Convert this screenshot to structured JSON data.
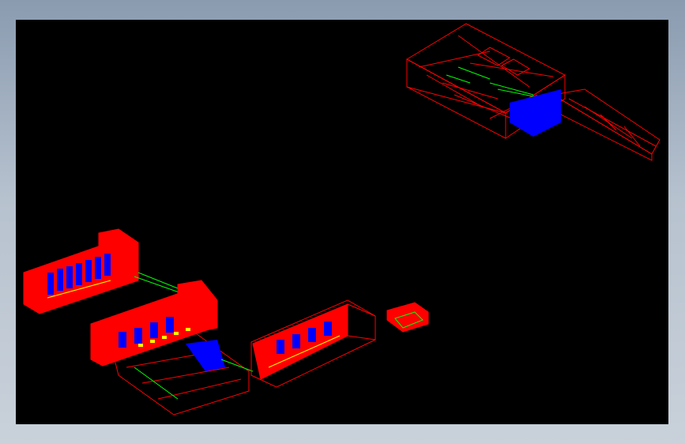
{
  "colors": {
    "frame_background": "#aeb9c6",
    "viewport_background": "#000000",
    "edge_red": "#ff0000",
    "edge_green": "#00ff00",
    "fill_blue": "#0000ff",
    "edge_yellow": "#ffff00"
  },
  "scene": {
    "models": [
      {
        "name": "isometric-duct-assembly-top-right"
      },
      {
        "name": "isometric-block-left-long"
      },
      {
        "name": "isometric-block-center-left"
      },
      {
        "name": "isometric-block-center"
      },
      {
        "name": "isometric-block-small-right"
      }
    ]
  }
}
